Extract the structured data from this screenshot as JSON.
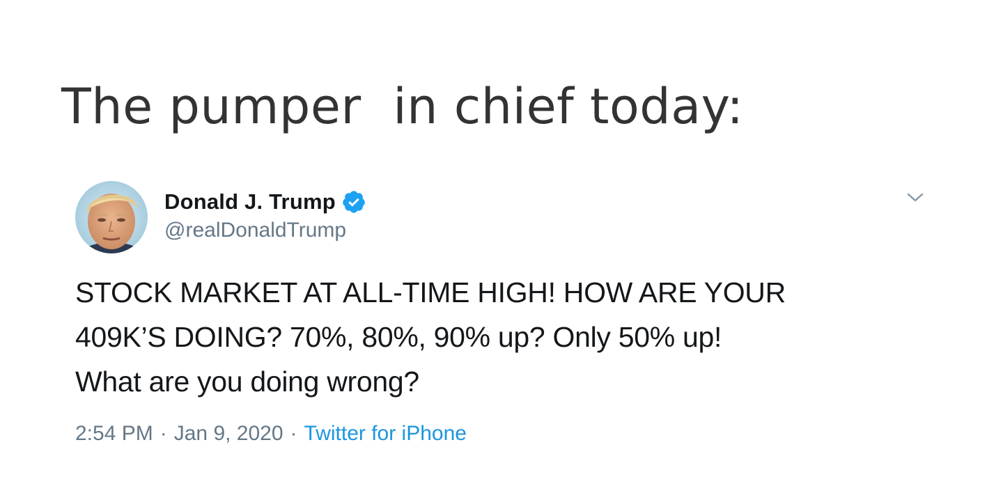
{
  "caption": "The pumper  in chief today:",
  "tweet": {
    "display_name": "Donald J. Trump",
    "handle": "@realDonaldTrump",
    "verified": true,
    "text_lines": [
      "STOCK MARKET AT ALL-TIME HIGH! HOW ARE YOUR",
      "409K’S DOING? 70%, 80%, 90% up? Only 50% up!",
      "What are you doing wrong?"
    ],
    "time": "2:54 PM",
    "date": "Jan 9, 2020",
    "separator": "·",
    "source": "Twitter for iPhone"
  },
  "colors": {
    "caption": "#333333",
    "name": "#14171a",
    "secondary": "#657786",
    "link": "#1b95e0",
    "verified_badge": "#1da1f2"
  },
  "icons": {
    "verified": "verified-badge-icon",
    "menu": "chevron-down-icon",
    "avatar": "profile-avatar"
  }
}
